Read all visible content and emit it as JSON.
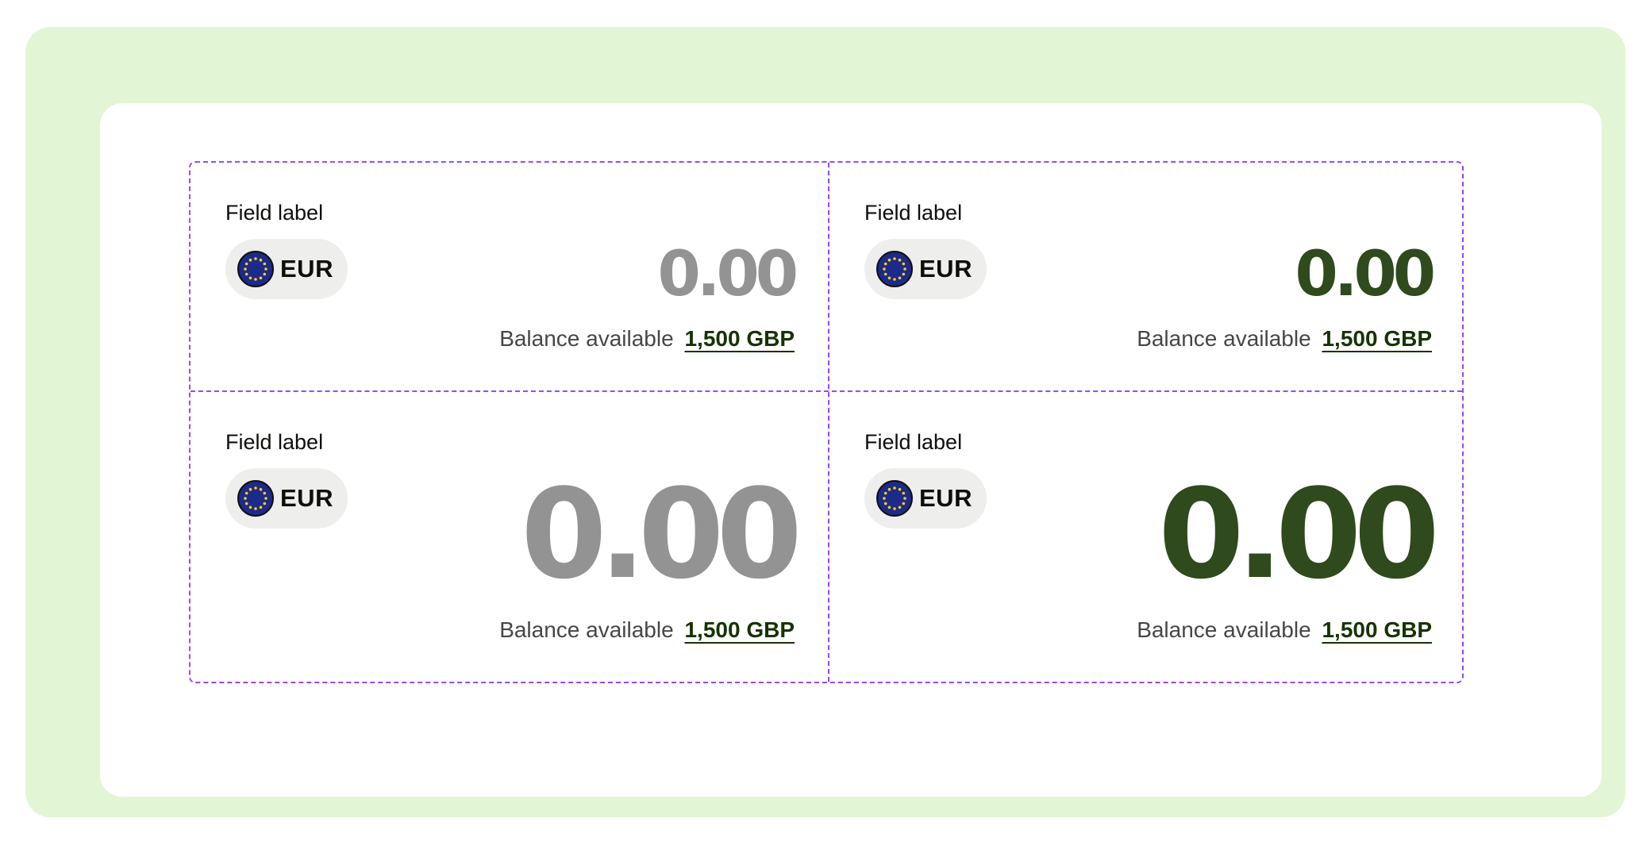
{
  "colors": {
    "outer_background": "#e2f6d5",
    "guide_dashes": "#9747ff",
    "amount_placeholder": "#939393",
    "amount_filled": "#2f4a1d",
    "link": "#163300",
    "pill_background": "#eeefec"
  },
  "fields": [
    {
      "label": "Field label",
      "currency_code": "EUR",
      "currency_icon": "eu-flag-icon",
      "amount": "0.00",
      "amount_state": "placeholder",
      "size": "small",
      "balance_label": "Balance available",
      "balance_value": "1,500 GBP"
    },
    {
      "label": "Field label",
      "currency_code": "EUR",
      "currency_icon": "eu-flag-icon",
      "amount": "0.00",
      "amount_state": "filled",
      "size": "small",
      "balance_label": "Balance available",
      "balance_value": "1,500 GBP"
    },
    {
      "label": "Field label",
      "currency_code": "EUR",
      "currency_icon": "eu-flag-icon",
      "amount": "0.00",
      "amount_state": "placeholder",
      "size": "large",
      "balance_label": "Balance available",
      "balance_value": "1,500 GBP"
    },
    {
      "label": "Field label",
      "currency_code": "EUR",
      "currency_icon": "eu-flag-icon",
      "amount": "0.00",
      "amount_state": "filled",
      "size": "large",
      "balance_label": "Balance available",
      "balance_value": "1,500 GBP"
    }
  ]
}
